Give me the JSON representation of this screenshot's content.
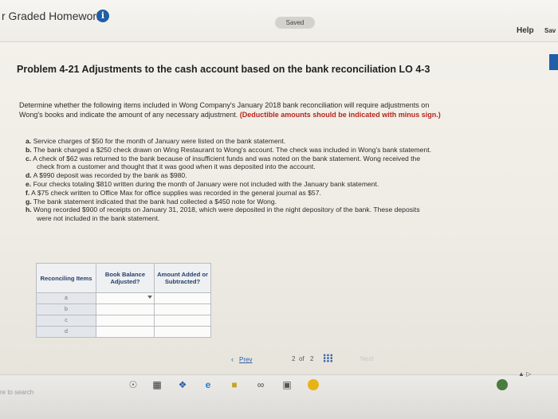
{
  "header": {
    "app_title": "r Graded Homework",
    "info_icon": "i",
    "saved_label": "Saved",
    "help_label": "Help",
    "save_label": "Sav"
  },
  "problem": {
    "title": "Problem 4-21 Adjustments to the cash account based on the bank reconciliation LO 4-3",
    "instructions_line1": "Determine whether the following items included in Wong Company's January 2018 bank reconciliation will require adjustments on",
    "instructions_line2": "Wong's books and indicate the amount of any necessary adjustment.",
    "instructions_note": "(Deductible amounts should be indicated with minus sign.)",
    "items": [
      {
        "label": "a.",
        "text": "Service charges of $50 for the month of January were listed on the bank statement."
      },
      {
        "label": "b.",
        "text": "The bank charged a $250 check drawn on Wing Restaurant to Wong's account. The check was included in Wong's bank statement."
      },
      {
        "label": "c.",
        "text": "A check of $62 was returned to the bank because of insufficient funds and was noted on the bank statement. Wong received the",
        "cont": "check from a customer and thought that it was good when it was deposited into the account."
      },
      {
        "label": "d.",
        "text": "A $990 deposit was recorded by the bank as $980."
      },
      {
        "label": "e.",
        "text": "Four checks totaling $810 written during the month of January were not included with the January bank statement."
      },
      {
        "label": "f.",
        "text": "A $75 check written to Office Max for office supplies was recorded in the general journal as $57."
      },
      {
        "label": "g.",
        "text": "The bank statement indicated that the bank had collected a $450 note for Wong."
      },
      {
        "label": "h.",
        "text": "Wong recorded $900 of receipts on January 31, 2018, which were deposited in the night depository of the bank. These deposits",
        "cont": "were not included in the bank statement."
      }
    ]
  },
  "table": {
    "headers": [
      "Reconciling Items",
      "Book Balance Adjusted?",
      "Amount Added or Subtracted?"
    ],
    "rows": [
      "a",
      "b",
      "c",
      "d"
    ]
  },
  "pagination": {
    "prev_label": "Prev",
    "current_page": "2",
    "of_label": "of",
    "total_pages": "2",
    "next_label": "Next"
  },
  "taskbar": {
    "search_placeholder": "re to search"
  },
  "colors": {
    "accent_blue": "#1f5fa8",
    "note_red": "#b8251c",
    "table_text": "#27406b"
  }
}
